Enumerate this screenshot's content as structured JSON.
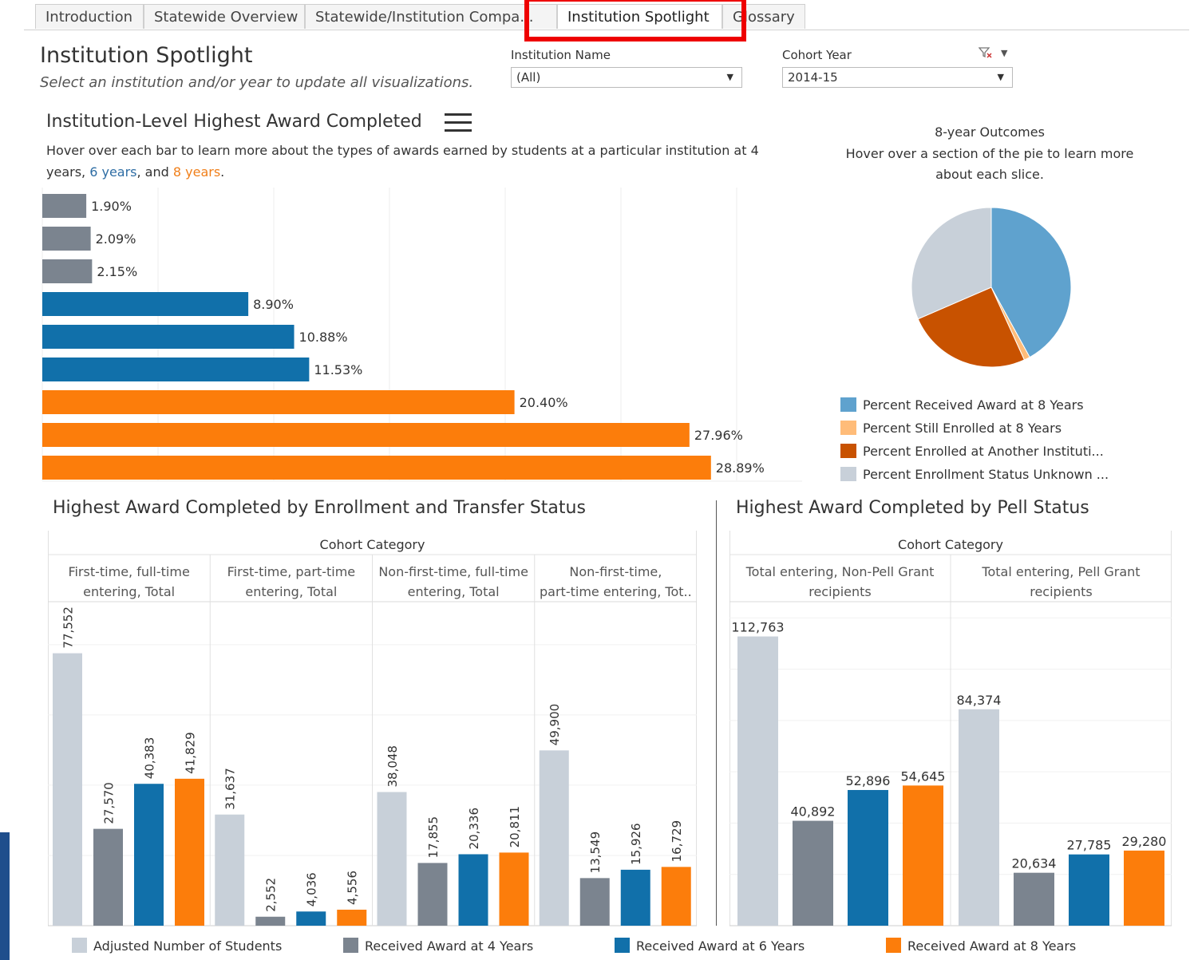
{
  "tabs": [
    {
      "label": "Introduction"
    },
    {
      "label": "Statewide Overview"
    },
    {
      "label": "Statewide/Institution Compa..."
    },
    {
      "label": "Institution Spotlight"
    },
    {
      "label": "Glossary"
    }
  ],
  "page": {
    "title": "Institution Spotlight",
    "subtitle": "Select an institution and/or year to update all visualizations."
  },
  "filters": {
    "institution": {
      "label": "Institution Name",
      "value": "(All)"
    },
    "cohort": {
      "label": "Cohort Year",
      "value": "2014-15"
    }
  },
  "bar_section": {
    "title": "Institution-Level Highest Award Completed",
    "desc_prefix": "Hover over each bar to learn more about the types of awards earned by students at a particular institution at 4 years, ",
    "desc_6": "6 years",
    "desc_mid": ", and ",
    "desc_8": "8 years",
    "desc_end": "."
  },
  "pie_section": {
    "title": "8-year Outcomes",
    "desc": "Hover over a section of the pie to learn more about each slice.",
    "legend": [
      {
        "label": "Percent Received Award at 8 Years",
        "color": "#5fa2ce"
      },
      {
        "label": "Percent Still Enrolled at 8 Years",
        "color": "#ffbc79"
      },
      {
        "label": "Percent Enrolled at Another Instituti...",
        "color": "#c85200"
      },
      {
        "label": "Percent Enrollment Status Unknown ...",
        "color": "#c8d0d9"
      }
    ]
  },
  "enroll_section": {
    "title": "Highest Award Completed by Enrollment and Transfer Status",
    "header": "Cohort Category"
  },
  "pell_section": {
    "title": "Highest Award Completed by Pell Status",
    "header": "Cohort Category"
  },
  "bottom_legend": [
    {
      "label": "Adjusted Number of Students",
      "color": "#c8d0d9"
    },
    {
      "label": "Received Award at 4 Years",
      "color": "#7b848f"
    },
    {
      "label": "Received Award at 6 Years",
      "color": "#1170aa"
    },
    {
      "label": "Received Award at 8 Years",
      "color": "#fc7d0b"
    }
  ],
  "chart_data": [
    {
      "type": "bar",
      "orientation": "horizontal",
      "title": "Institution-Level Highest Award Completed",
      "values": [
        1.9,
        2.09,
        2.15,
        8.9,
        10.88,
        11.53,
        20.4,
        27.96,
        28.89
      ],
      "labels": [
        "1.90%",
        "2.09%",
        "2.15%",
        "8.90%",
        "10.88%",
        "11.53%",
        "20.40%",
        "27.96%",
        "28.89%"
      ],
      "groups": [
        "4 years",
        "4 years",
        "4 years",
        "6 years",
        "6 years",
        "6 years",
        "8 years",
        "8 years",
        "8 years"
      ],
      "colors": [
        "#7b848f",
        "#7b848f",
        "#7b848f",
        "#1170aa",
        "#1170aa",
        "#1170aa",
        "#fc7d0b",
        "#fc7d0b",
        "#fc7d0b"
      ],
      "xlim": [
        0,
        33
      ],
      "grid": true
    },
    {
      "type": "pie",
      "title": "8-year Outcomes",
      "slices": [
        {
          "name": "Percent Received Award at 8 Years",
          "value": 42,
          "color": "#5fa2ce"
        },
        {
          "name": "Percent Still Enrolled at 8 Years",
          "value": 1.2,
          "color": "#ffbc79"
        },
        {
          "name": "Percent Enrolled at Another Instituti...",
          "value": 25.3,
          "color": "#c85200"
        },
        {
          "name": "Percent Enrollment Status Unknown ...",
          "value": 31.5,
          "color": "#c8d0d9"
        }
      ]
    },
    {
      "type": "bar",
      "title": "Highest Award Completed by Enrollment and Transfer Status",
      "categories": [
        [
          "First-time, full-time",
          "entering, Total"
        ],
        [
          "First-time, part-time",
          "entering, Total"
        ],
        [
          "Non-first-time, full-time",
          "entering, Total"
        ],
        [
          "Non-first-time,",
          "part-time entering, Tot.."
        ]
      ],
      "series": [
        {
          "name": "Adjusted Number of Students",
          "values": [
            77552,
            31637,
            38048,
            49900
          ],
          "labels": [
            "77,552",
            "31,637",
            "38,048",
            "49,900"
          ]
        },
        {
          "name": "Received Award at 4 Years",
          "values": [
            27570,
            2552,
            17855,
            13549
          ],
          "labels": [
            "27,570",
            "2,552",
            "17,855",
            "13,549"
          ]
        },
        {
          "name": "Received Award at 6 Years",
          "values": [
            40383,
            4036,
            20336,
            15926
          ],
          "labels": [
            "40,383",
            "4,036",
            "20,336",
            "15,926"
          ]
        },
        {
          "name": "Received Award at 8 Years",
          "values": [
            41829,
            4556,
            20811,
            16729
          ],
          "labels": [
            "41,829",
            "4,556",
            "20,811",
            "16,729"
          ]
        }
      ],
      "ylim": [
        0,
        92000
      ]
    },
    {
      "type": "bar",
      "title": "Highest Award Completed by Pell Status",
      "categories": [
        [
          "Total entering, Non-Pell Grant",
          "recipients"
        ],
        [
          "Total entering, Pell Grant",
          "recipients"
        ]
      ],
      "series": [
        {
          "name": "Adjusted Number of Students",
          "values": [
            112763,
            84374
          ],
          "labels": [
            "112,763",
            "84,374"
          ]
        },
        {
          "name": "Received Award at 4 Years",
          "values": [
            40892,
            20634
          ],
          "labels": [
            "40,892",
            "20,634"
          ]
        },
        {
          "name": "Received Award at 6 Years",
          "values": [
            52896,
            27785
          ],
          "labels": [
            "52,896",
            "27,785"
          ]
        },
        {
          "name": "Received Award at 8 Years",
          "values": [
            54645,
            29280
          ],
          "labels": [
            "54,645",
            "29,280"
          ]
        }
      ],
      "ylim": [
        0,
        126000
      ]
    }
  ]
}
